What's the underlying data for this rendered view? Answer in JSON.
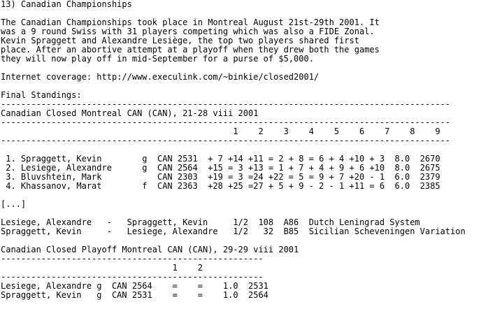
{
  "heading": "13) Canadian Championships",
  "intro": [
    "The Canadian Championships took place in Montreal August 21st-29th 2001. It",
    "was a 9 round Swiss with 31 players competing which was also a FIDE Zonal.",
    "Kevin Spraggett and Alexandre Lesiège, the top two players shared first",
    "place. After an abortive attempt at a playoff when they drew both the games",
    "they will now play off in mid-September for a purse of $5,000."
  ],
  "internet": "Internet coverage: http://www.execulink.com/~binkie/closed2001/",
  "final_label": "Final Standings:",
  "rule_long": "-----------------------------------------------------------------------------------------",
  "closed_title": "Canadian Closed Montreal CAN (CAN), 21-28 viii 2001",
  "closed_rounds": "                                              1    2    3    4    5    6    7    8    9",
  "closed_rows": [
    " 1. Spraggett, Kevin        g  CAN 2531  + 7 +14 +11 = 2 + 8 = 6 + 4 +10 + 3  8.0  2670",
    " 2. Lesiege, Alexandre      g  CAN 2564  +15 = 3 +13 = 1 + 7 + 4 + 9 + 6 +10  8.0  2675",
    " 3. Bluvshtein, Mark           CAN 2303  +19 = 3 =24 +22 = 5 = 9 + 7 +20 - 1  6.0  2379",
    " 4. Khassanov, Marat        f  CAN 2363  +28 +25 =27 + 5 + 9 - 2 - 1 +11 = 6  6.0  2385"
  ],
  "ellipsis": "[...]",
  "games": [
    "Lesiege, Alexandre   -   Spraggett, Kevin     1/2  108  A86  Dutch Leningrad System",
    "Spraggett, Kevin     -   Lesiege, Alexandre   1/2   32  B85  Sicilian Scheveningen Variation"
  ],
  "playoff_title": "Canadian Closed Playoff Montreal CAN (CAN), 29-29 viii 2001",
  "rule_short": "----------------------------------------------------",
  "playoff_rounds": "                                  1    2",
  "playoff_rows": [
    "Lesiege, Alexandre g  CAN 2564    =    =    1.0  2531",
    "Spraggett, Kevin   g  CAN 2531    =    =    1.0  2564"
  ]
}
